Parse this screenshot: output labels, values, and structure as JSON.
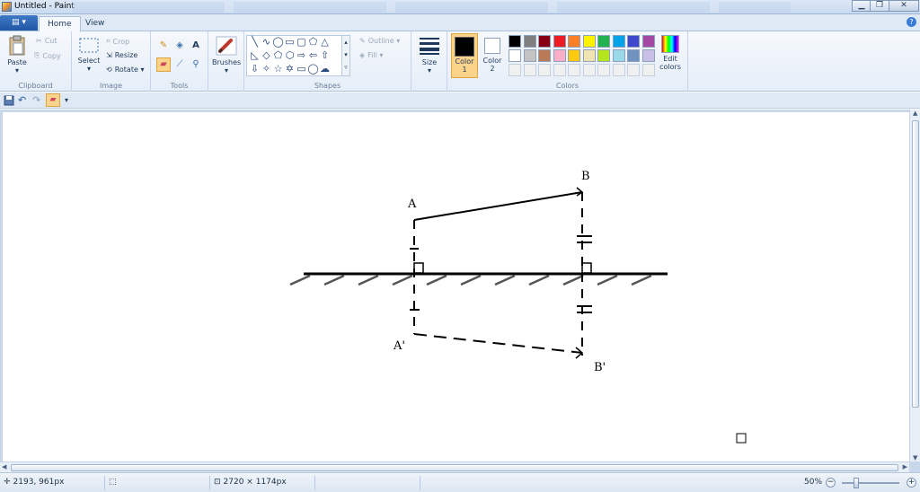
{
  "window": {
    "title": "Untitled - Paint",
    "buttons": {
      "minimize": "▁",
      "maximize": "❐",
      "close": "✕"
    }
  },
  "ribbon": {
    "file_menu": "▤ ▾",
    "tabs": [
      "Home",
      "View"
    ],
    "help": "?",
    "clipboard": {
      "paste": "Paste",
      "cut": "Cut",
      "copy": "Copy",
      "label": "Clipboard"
    },
    "image": {
      "select": "Select",
      "crop": "Crop",
      "resize": "Resize",
      "rotate": "Rotate ▾",
      "label": "Image"
    },
    "tools": {
      "label": "Tools"
    },
    "brushes": {
      "label_text": "Brushes"
    },
    "shapes": {
      "outline": "Outline ▾",
      "fill": "Fill ▾",
      "label": "Shapes"
    },
    "size": {
      "label_text": "Size"
    },
    "colors": {
      "color1": "Color",
      "color1_num": "1",
      "color2": "Color",
      "color2_num": "2",
      "edit": "Edit",
      "edit2": "colors",
      "label": "Colors",
      "palette_row1": [
        "#000000",
        "#7f7f7f",
        "#880015",
        "#ed1c24",
        "#ff7f27",
        "#fff200",
        "#22b14c",
        "#00a2e8",
        "#3f48cc",
        "#a349a4"
      ],
      "palette_row2": [
        "#ffffff",
        "#c3c3c3",
        "#b97a57",
        "#ffaec9",
        "#ffc90e",
        "#efe4b0",
        "#b5e61d",
        "#99d9ea",
        "#7092be",
        "#c8bfe7"
      ]
    }
  },
  "canvas_drawing": {
    "label_a": "A",
    "label_b": "B",
    "label_a_prime": "A'",
    "label_b_prime": "B'"
  },
  "status": {
    "cursor_pos": "2193, 961px",
    "image_size": "2720 × 1174px",
    "zoom": "50%"
  },
  "icons": [
    "paste-icon",
    "cut-icon",
    "copy-icon",
    "select-icon",
    "crop-icon",
    "resize-icon",
    "rotate-icon",
    "pencil-icon",
    "fill-icon",
    "text-icon",
    "eraser-icon",
    "color-picker-icon",
    "magnifier-icon",
    "brush-icon",
    "size-icon",
    "edit-colors-icon",
    "save-icon",
    "undo-icon",
    "redo-icon"
  ]
}
